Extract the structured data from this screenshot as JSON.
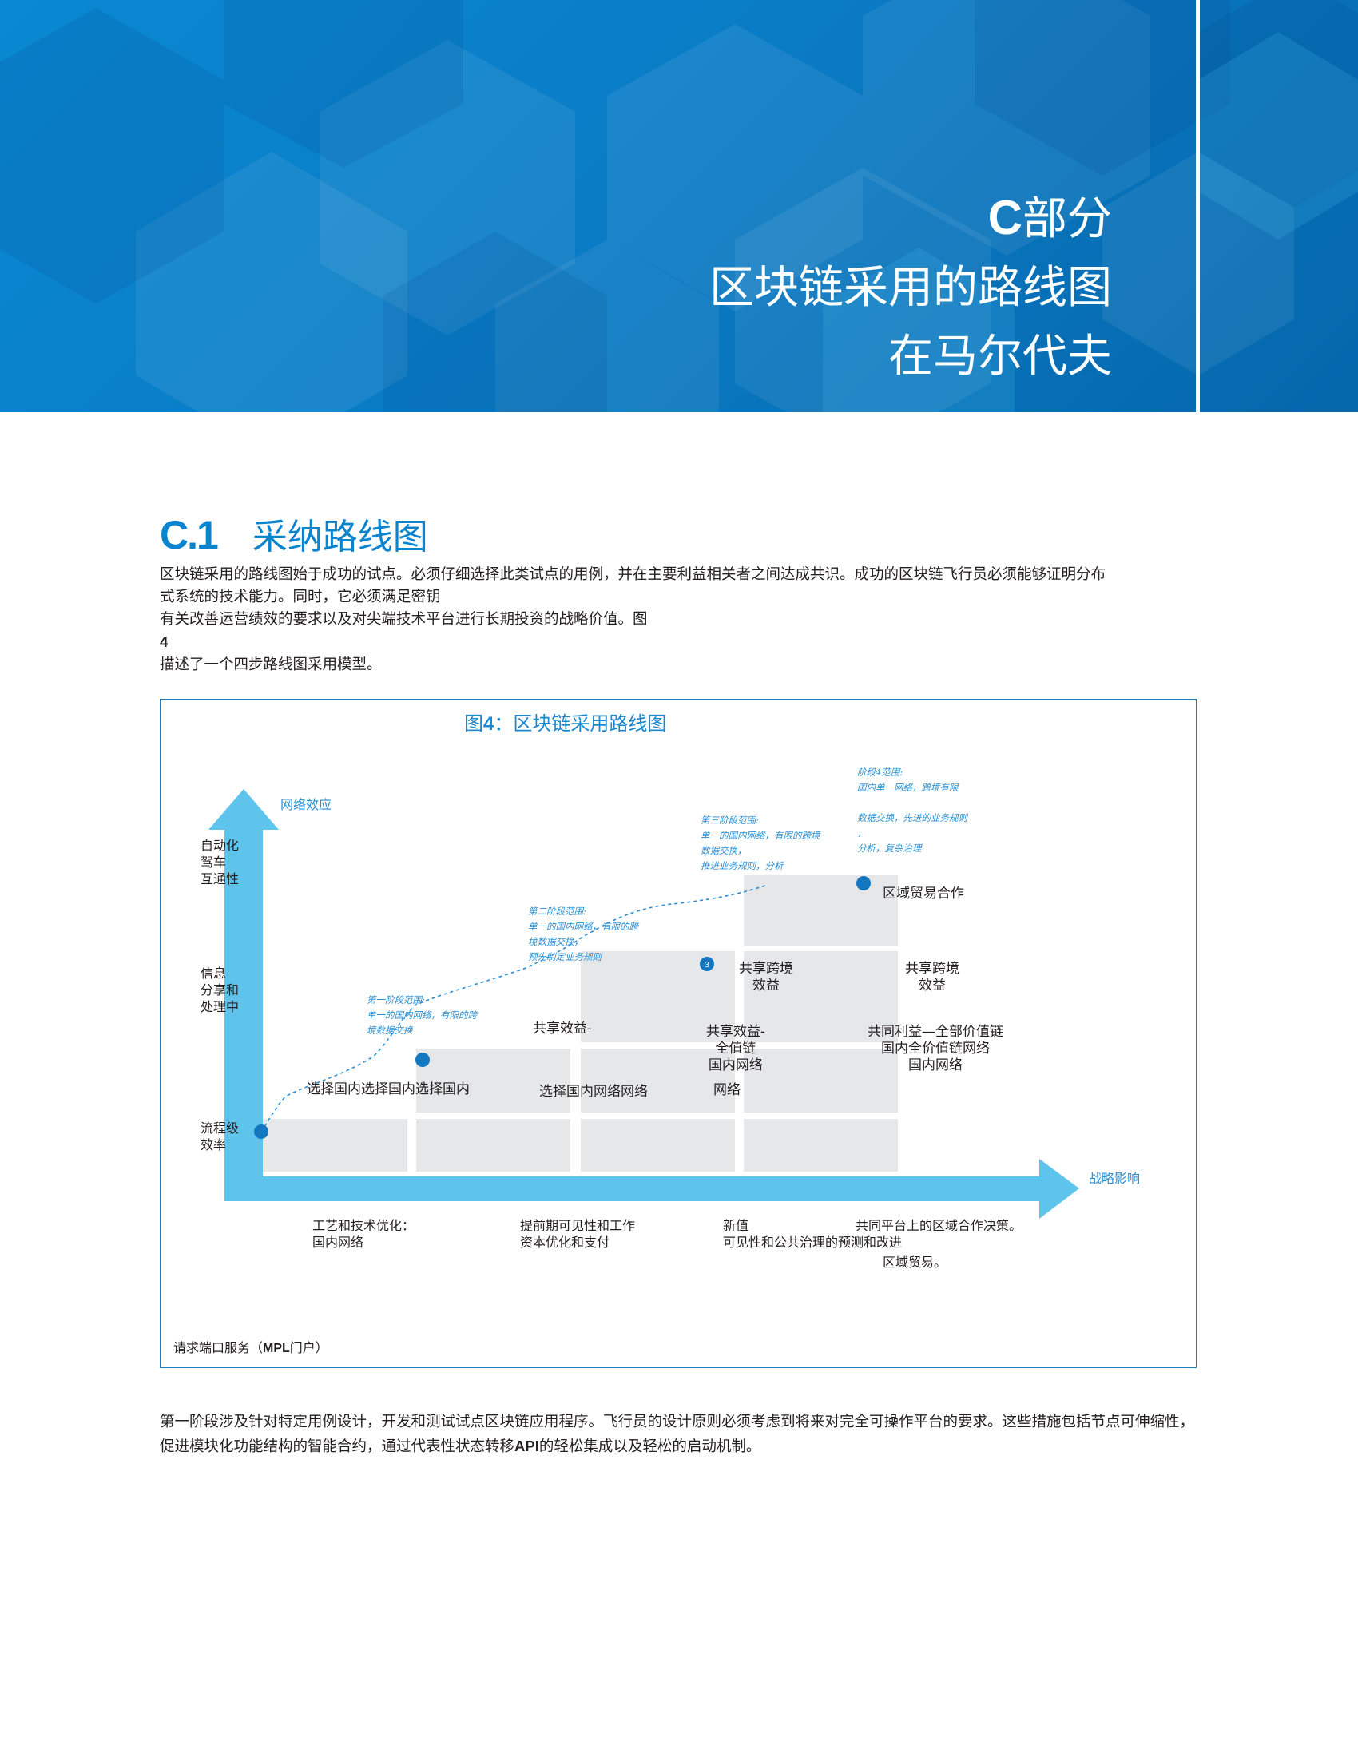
{
  "header": {
    "part_letter": "C",
    "part_word": "部分",
    "title_line1": "区块链采用的路线图",
    "title_line2": "在马尔代夫"
  },
  "section": {
    "number": "C.1",
    "title": "采纳路线图"
  },
  "intro": {
    "line1": "区块链采用的路线图始于成功的试点。必须仔细选择此类试点的用例，并在主要利益相关者之间达成共识。成功的区块链飞行员必须能够证明分布",
    "line2": "式系统的技术能力。同时，它必须满足密钥",
    "line3_pre": "有关改善运营绩效的要求以及对尖端技术平台进行长期投资的战略价值。图",
    "line3_num": "4",
    "line3_post": "描述了一个四步路线图采用模型。"
  },
  "figure": {
    "title_pre": "图",
    "title_num": "4",
    "title_post": "：区块链采用路线图",
    "y_axis_label": "网络效应",
    "x_axis_label": "战略影响",
    "y_levels": [
      "自动化\n驾车\n互通性",
      "信息\n分享和\n处理中",
      "流程级\n效率"
    ],
    "stage_notes": [
      "第一阶段范围:\n单一的国内网络，有限的跨\n境数据交换",
      "第二阶段范围:\n单一的国内网络，有限的跨\n境数据交换，\n预先制定业务规则",
      "第三阶段范围:\n单一的国内网络，有限的跨境\n数据交换，\n推进业务规则，分析",
      "阶段4范围:\n国内单一网络，跨境有限\n\n数据交换，先进的业务规则\n，\n分析，复杂治理"
    ],
    "stage_markers": [
      "",
      "",
      "3",
      ""
    ],
    "cells": {
      "c1_label": "选择国内选择国内选择国内",
      "c2_top": "共享效益-",
      "c2_label": "选择国内网络网络",
      "c3_top": "共享跨境\n效益",
      "c3_mid": "共享效益-\n全值链\n国内网络",
      "c3_low": "网络",
      "c4_top": "区域贸易合作",
      "c4_mid": "共享跨境\n效益",
      "c4_low": "共同利益—全部价值链\n国内全价值链网络\n国内网络"
    },
    "stage_descriptions": [
      "工艺和技术优化：\n国内网络",
      "提前期可见性和工作\n资本优化和支付",
      "新值\n可见性和公共治理的预测和改进",
      "共同平台上的区域合作决策。",
      "区域贸易。"
    ],
    "source_pre": "请求端口服务（",
    "source_bold": "MPL",
    "source_post": "门户）"
  },
  "closing": {
    "text_pre": "第一阶段涉及针对特定用例设计，开发和测试试点区块链应用程序。飞行员的设计原则必须考虑到将来对完全可操作平台的要求。这些措施包括节点可伸缩性，促进模块化功能结构的智能合约，通过代表性状态转移",
    "text_bold": "API",
    "text_post": "的轻松集成以及轻松的启动机制。"
  },
  "colors": {
    "banner_blue": "#0a7cc6",
    "accent_blue": "#0a84cf",
    "arrow_blue": "#5fc4ec",
    "cell_gray": "#e6e7e8",
    "marker_blue": "#1478c0"
  }
}
